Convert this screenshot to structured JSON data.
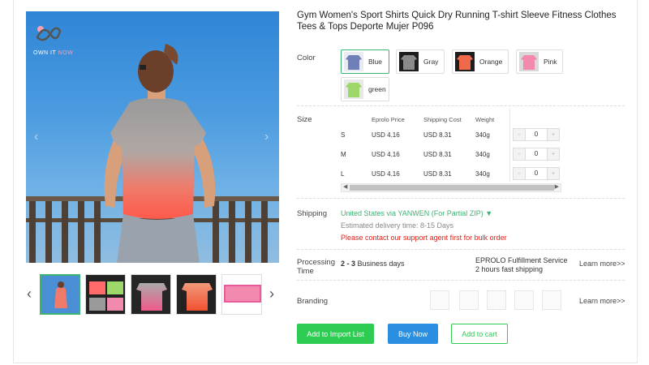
{
  "product": {
    "title": "Gym Women's Sport Shirts Quick Dry Running T-shirt Sleeve Fitness Clothes Tees & Tops Deporte Mujer P096"
  },
  "logo": {
    "text_main": "OWN IT ",
    "text_accent": "NOW"
  },
  "labels": {
    "color": "Color",
    "size": "Size",
    "shipping": "Shipping",
    "processing": "Processing",
    "processing_2": "Time",
    "branding": "Branding"
  },
  "colors": [
    {
      "label": "Blue",
      "hex": "#6f7fb8"
    },
    {
      "label": "Gray",
      "hex": "#8a8a8a"
    },
    {
      "label": "Orange",
      "hex": "#f06a4a"
    },
    {
      "label": "Pink",
      "hex": "#f28ab0"
    },
    {
      "label": "green",
      "hex": "#9fd86a"
    }
  ],
  "size_table": {
    "headers": [
      "Eprolo Price",
      "Shipping Cost",
      "Weight"
    ],
    "rows": [
      {
        "size": "S",
        "price": "USD 4.16",
        "shipping": "USD 8.31",
        "weight": "340g",
        "qty": "0"
      },
      {
        "size": "M",
        "price": "USD 4.16",
        "shipping": "USD 8.31",
        "weight": "340g",
        "qty": "0"
      },
      {
        "size": "L",
        "price": "USD 4.16",
        "shipping": "USD 8.31",
        "weight": "340g",
        "qty": "0"
      }
    ],
    "minus": "-",
    "plus": "+"
  },
  "shipping": {
    "method": "United States via YANWEN (For Partial ZIP) ▼",
    "estimate": "Estimated delivery time: 8-15 Days",
    "warning": "Please contact our support agent first for bulk order"
  },
  "processing": {
    "days_bold": "2 - 3",
    "days_rest": " Business days",
    "service_1": "EPROLO Fulfillment Service",
    "service_2": "2 hours fast shipping",
    "learn_more": "Learn more>>"
  },
  "branding": {
    "learn_more": "Learn more>>"
  },
  "buttons": {
    "import": "Add to Import List",
    "buy": "Buy Now",
    "cart": "Add to cart"
  },
  "accent": {
    "green": "#2ecc53",
    "blue": "#2a8fe0",
    "red": "#e0201a"
  }
}
